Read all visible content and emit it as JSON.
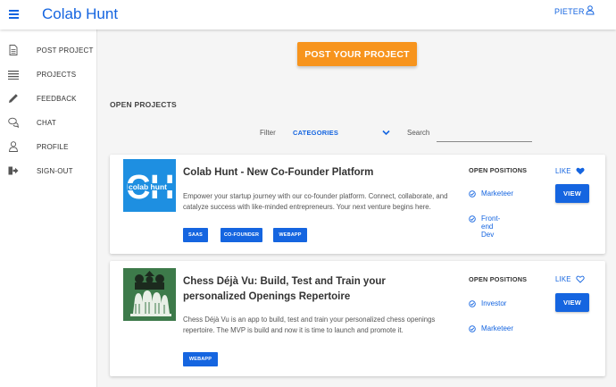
{
  "app": {
    "title": "Colab Hunt"
  },
  "header": {
    "user_name": "PIETER",
    "menu_icon": "hamburger-menu-icon",
    "user_icon": "user-icon"
  },
  "sidebar": {
    "items": [
      {
        "label": "POST PROJECT",
        "icon": "document-icon"
      },
      {
        "label": "PROJECTS",
        "icon": "list-icon"
      },
      {
        "label": "FEEDBACK",
        "icon": "pencil-icon"
      },
      {
        "label": "CHAT",
        "icon": "chat-icon"
      },
      {
        "label": "PROFILE",
        "icon": "person-icon"
      },
      {
        "label": "SIGN-OUT",
        "icon": "sign-out-icon"
      }
    ]
  },
  "main": {
    "post_button": "POST YOUR PROJECT",
    "section_title": "OPEN PROJECTS",
    "filter": {
      "label": "Filter",
      "selected": "CATEGORIES"
    },
    "search": {
      "label": "Search",
      "value": ""
    }
  },
  "projects": [
    {
      "title": "Colab Hunt - New Co-Founder Platform",
      "description": "Empower your startup journey with our co-founder platform. Connect, collaborate, and catalyze success with like-minded entrepreneurs. Your next venture begins here.",
      "tags": [
        "SAAS",
        "CO-FOUNDER",
        "WEBAPP"
      ],
      "positions_heading": "OPEN POSITIONS",
      "positions": [
        "Marketeer",
        "Front-end Dev"
      ],
      "like_label": "LIKE",
      "liked": true,
      "view_label": "VIEW",
      "logo_text": "colab hunt"
    },
    {
      "title": "Chess Déjà Vu: Build, Test  and Train your personalized Openings Repertoire",
      "description": "Chess Déjà Vu is an app to build, test and train your personalized chess openings repertoire. The MVP is build and now it is time to launch and promote it.",
      "tags": [
        "WEBAPP"
      ],
      "positions_heading": "OPEN POSITIONS",
      "positions": [
        "Investor",
        "Marketeer"
      ],
      "like_label": "LIKE",
      "liked": false,
      "view_label": "VIEW"
    }
  ],
  "colors": {
    "primary": "#1565e0",
    "accent": "#f7941d",
    "logo_blue": "#1e8fe1",
    "chess_green": "#3d7a4a"
  }
}
